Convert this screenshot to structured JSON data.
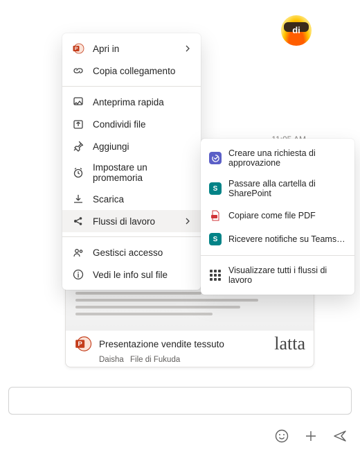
{
  "avatar": {
    "initials": "di"
  },
  "timestamp": "11:05 AM",
  "menu1": {
    "open_in": "Apri in",
    "copy_link": "Copia collegamento",
    "quick_preview": "Anteprima rapida",
    "share_file": "Condividi file",
    "pin": "Aggiungi",
    "set_reminder": "Impostare un promemoria",
    "download": "Scarica",
    "workflows": "Flussi di lavoro",
    "manage_access": "Gestisci accesso",
    "file_info": "Vedi le info sul file"
  },
  "menu2": {
    "approval": "Creare una richiesta di approvazione",
    "sharepoint": "Passare alla cartella di SharePoint",
    "copy_pdf": "Copiare come file PDF",
    "teams_notify": "Ricevere notifiche su Teams…",
    "view_all": "Visualizzare tutti i flussi di lavoro"
  },
  "card": {
    "title": "Presentazione vendite tessuto",
    "author": "Daisha",
    "source": "File di Fukuda",
    "overlay": "latta"
  }
}
